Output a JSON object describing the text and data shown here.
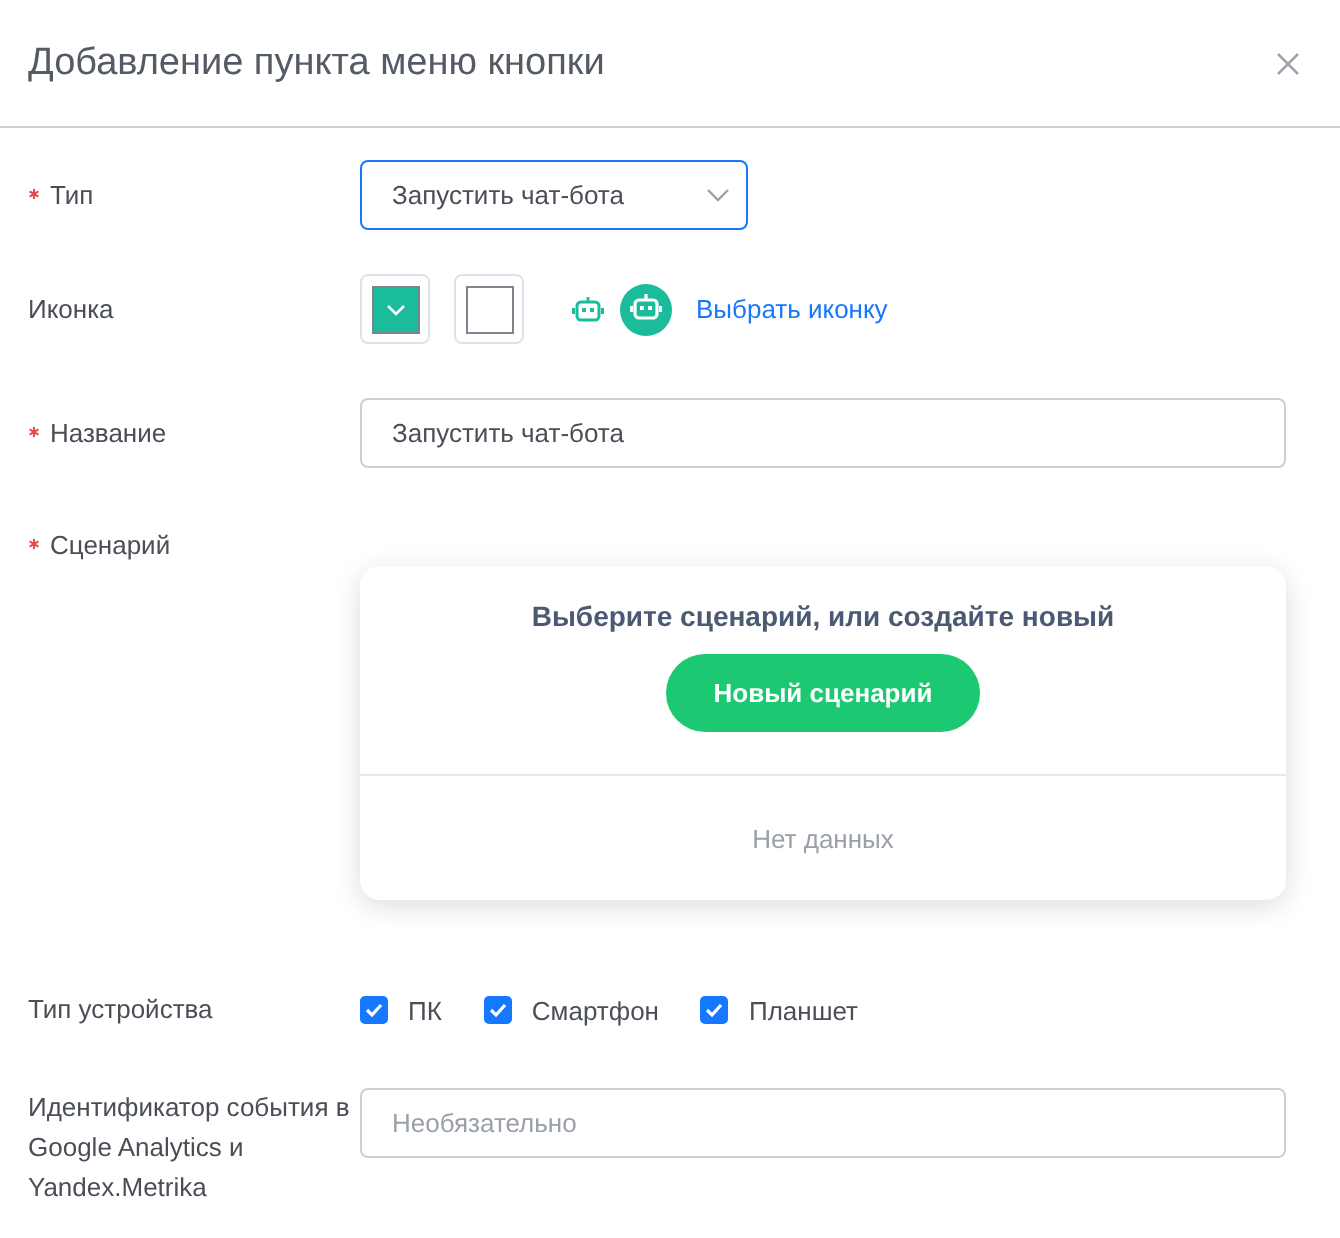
{
  "dialog": {
    "title": "Добавление пункта меню кнопки"
  },
  "type_field": {
    "label": "Тип",
    "required": true,
    "value": "Запустить чат-бота",
    "focused": true
  },
  "icon_field": {
    "label": "Иконка",
    "required": false,
    "swatches": [
      {
        "color": "#1abc9c",
        "kind": "picker"
      },
      {
        "color": "#ffffff",
        "kind": "plain"
      }
    ],
    "link": "Выбрать иконку"
  },
  "name_field": {
    "label": "Название",
    "required": true,
    "value": "Запустить чат-бота"
  },
  "scenario_field": {
    "label": "Сценарий",
    "required": true,
    "heading": "Выберите сценарий, или создайте новый",
    "button": "Новый сценарий",
    "empty_text": "Нет данных"
  },
  "device_field": {
    "label": "Тип устройства",
    "required": false,
    "options": [
      {
        "label": "ПК",
        "checked": true
      },
      {
        "label": "Смартфон",
        "checked": true
      },
      {
        "label": "Планшет",
        "checked": true
      }
    ]
  },
  "event_field": {
    "label": "Идентификатор события в Google Analytics и Yandex.Metrika",
    "required": false,
    "placeholder": "Необязательно"
  }
}
